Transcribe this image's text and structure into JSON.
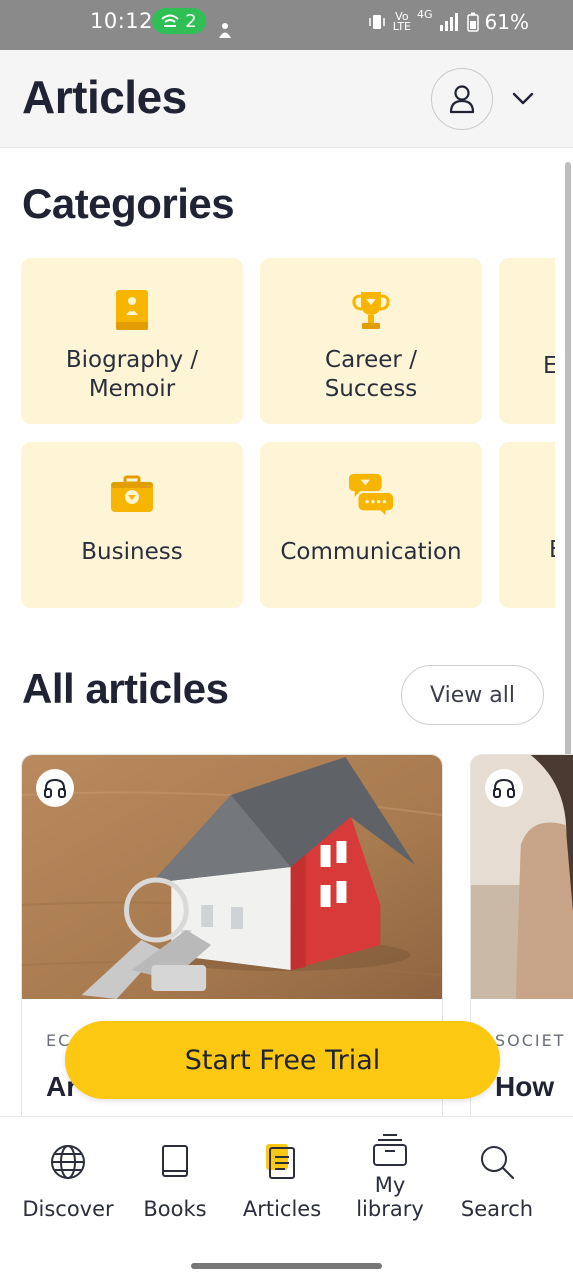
{
  "status_bar": {
    "time": "10:12",
    "wifi_count": "2",
    "battery": "61%",
    "volte_line1": "Vo",
    "volte_line2": "LTE",
    "network": "4G"
  },
  "header": {
    "title": "Articles"
  },
  "categories": {
    "title": "Categories",
    "items": [
      {
        "label": "Biography /\nMemoir",
        "icon": "biography-book-icon"
      },
      {
        "label": "Career /\nSuccess",
        "icon": "trophy-icon"
      },
      {
        "label": "E",
        "icon": "partial-category-icon"
      },
      {
        "label": "Business",
        "icon": "briefcase-icon"
      },
      {
        "label": "Communication",
        "icon": "chat-bubbles-icon"
      },
      {
        "label": "E",
        "icon": "partial-category-icon"
      }
    ]
  },
  "all_articles": {
    "title": "All articles",
    "view_all_label": "View all",
    "items": [
      {
        "category": "EC",
        "title": "Ar",
        "has_audio": true,
        "image": "house-model-with-keys"
      },
      {
        "category": "SOCIET",
        "title": "How",
        "has_audio": true,
        "image": "person-portrait"
      }
    ]
  },
  "cta": {
    "label": "Start Free Trial"
  },
  "bottom_nav": [
    {
      "label": "Discover",
      "icon": "globe-icon"
    },
    {
      "label": "Books",
      "icon": "book-icon"
    },
    {
      "label": "Articles",
      "icon": "articles-icon",
      "active": true
    },
    {
      "label": "My\nlibrary",
      "icon": "library-icon"
    },
    {
      "label": "Search",
      "icon": "search-icon"
    }
  ],
  "colors": {
    "accent_yellow": "#fdc811",
    "category_bg": "#fdf5d6",
    "text_dark": "#1f2333",
    "status_bar_bg": "#8a8a8a",
    "wifi_pill": "#2fbf55"
  }
}
